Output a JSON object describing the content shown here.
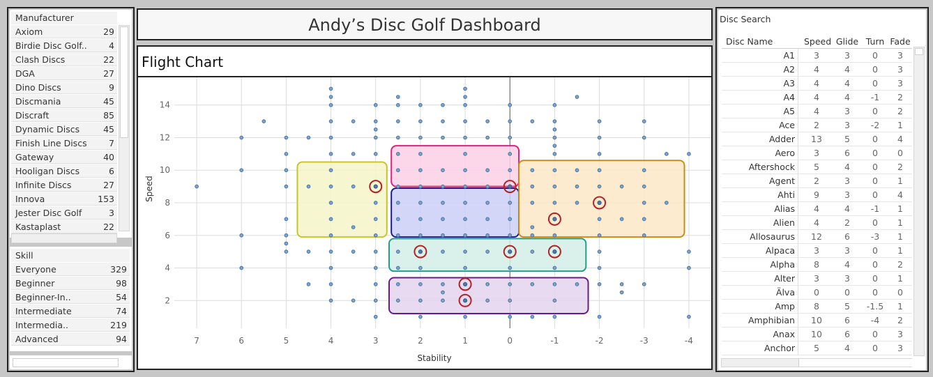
{
  "manufacturer": {
    "header": "Manufacturer",
    "items": [
      {
        "name": "Axiom",
        "count": "29"
      },
      {
        "name": "Birdie Disc Golf..",
        "count": "4"
      },
      {
        "name": "Clash Discs",
        "count": "22"
      },
      {
        "name": "DGA",
        "count": "27"
      },
      {
        "name": "Dino Discs",
        "count": "9"
      },
      {
        "name": "Discmania",
        "count": "45"
      },
      {
        "name": "Discraft",
        "count": "85"
      },
      {
        "name": "Dynamic Discs",
        "count": "45"
      },
      {
        "name": "Finish Line Discs",
        "count": "7"
      },
      {
        "name": "Gateway",
        "count": "40"
      },
      {
        "name": "Hooligan Discs",
        "count": "6"
      },
      {
        "name": "Infinite Discs",
        "count": "27"
      },
      {
        "name": "Innova",
        "count": "153"
      },
      {
        "name": "Jester Disc Golf",
        "count": "3"
      },
      {
        "name": "Kastaplast",
        "count": "22"
      }
    ]
  },
  "skill": {
    "header": "Skill",
    "items": [
      {
        "name": "Everyone",
        "count": "329"
      },
      {
        "name": "Beginner",
        "count": "98"
      },
      {
        "name": "Beginner-In..",
        "count": "54"
      },
      {
        "name": "Intermediate",
        "count": "74"
      },
      {
        "name": "Intermedia..",
        "count": "219"
      },
      {
        "name": "Advanced",
        "count": "94"
      }
    ]
  },
  "dashboard_title": "Andy’s Disc Golf Dashboard",
  "chart_title": "Flight Chart",
  "chart_data": {
    "type": "scatter",
    "xlabel": "Stability",
    "ylabel": "Speed",
    "xlim": [
      7.5,
      -4.5
    ],
    "ylim": [
      0.3,
      15.7
    ],
    "x_ticks": [
      7,
      6,
      5,
      4,
      3,
      2,
      1,
      0,
      -1,
      -2,
      -3,
      -4
    ],
    "y_ticks": [
      2,
      4,
      6,
      8,
      10,
      12,
      14
    ],
    "grid": true,
    "reversed_x": true,
    "points": [
      [
        7,
        9
      ],
      [
        6,
        12
      ],
      [
        6,
        10
      ],
      [
        6,
        6
      ],
      [
        6,
        4
      ],
      [
        5.5,
        13
      ],
      [
        5,
        12
      ],
      [
        5,
        11
      ],
      [
        5,
        10
      ],
      [
        5,
        9
      ],
      [
        5,
        7
      ],
      [
        5,
        6
      ],
      [
        5,
        5.5
      ],
      [
        5,
        5
      ],
      [
        4.5,
        12
      ],
      [
        4.5,
        9
      ],
      [
        4.5,
        5
      ],
      [
        4.5,
        3
      ],
      [
        4,
        15
      ],
      [
        4,
        14.5
      ],
      [
        4,
        14
      ],
      [
        4,
        13
      ],
      [
        4,
        12
      ],
      [
        4,
        11
      ],
      [
        4,
        10
      ],
      [
        4,
        9
      ],
      [
        4,
        8
      ],
      [
        4,
        7
      ],
      [
        4,
        6
      ],
      [
        4,
        5
      ],
      [
        4,
        4
      ],
      [
        4,
        3
      ],
      [
        4,
        2
      ],
      [
        3.5,
        13
      ],
      [
        3.5,
        11
      ],
      [
        3.5,
        9
      ],
      [
        3.5,
        6.5
      ],
      [
        3.5,
        5
      ],
      [
        3.5,
        2
      ],
      [
        3,
        14
      ],
      [
        3,
        13
      ],
      [
        3,
        12.5
      ],
      [
        3,
        12
      ],
      [
        3,
        11
      ],
      [
        3,
        9
      ],
      [
        3,
        8
      ],
      [
        3,
        7
      ],
      [
        3,
        6
      ],
      [
        3,
        5
      ],
      [
        3,
        4
      ],
      [
        3,
        3
      ],
      [
        3,
        2
      ],
      [
        3,
        1
      ],
      [
        2.5,
        14.5
      ],
      [
        2.5,
        14
      ],
      [
        2.5,
        13
      ],
      [
        2.5,
        12
      ],
      [
        2.5,
        11
      ],
      [
        2.5,
        10
      ],
      [
        2.5,
        9
      ],
      [
        2.5,
        8
      ],
      [
        2.5,
        7
      ],
      [
        2.5,
        6
      ],
      [
        2.5,
        5
      ],
      [
        2.5,
        4
      ],
      [
        2.5,
        3
      ],
      [
        2.5,
        2
      ],
      [
        2,
        14
      ],
      [
        2,
        13
      ],
      [
        2,
        12
      ],
      [
        2,
        11
      ],
      [
        2,
        10
      ],
      [
        2,
        9
      ],
      [
        2,
        8
      ],
      [
        2,
        7
      ],
      [
        2,
        6
      ],
      [
        2,
        5
      ],
      [
        2,
        4
      ],
      [
        2,
        3
      ],
      [
        2,
        2
      ],
      [
        2,
        1
      ],
      [
        1.5,
        14
      ],
      [
        1.5,
        13
      ],
      [
        1.5,
        12
      ],
      [
        1.5,
        10
      ],
      [
        1.5,
        9
      ],
      [
        1.5,
        8
      ],
      [
        1.5,
        7
      ],
      [
        1.5,
        6
      ],
      [
        1.5,
        5
      ],
      [
        1.5,
        3
      ],
      [
        1.5,
        2.5
      ],
      [
        1.5,
        2
      ],
      [
        1,
        15
      ],
      [
        1,
        14.5
      ],
      [
        1,
        14
      ],
      [
        1,
        13
      ],
      [
        1,
        12
      ],
      [
        1,
        11
      ],
      [
        1,
        10
      ],
      [
        1,
        9
      ],
      [
        1,
        8
      ],
      [
        1,
        7
      ],
      [
        1,
        6
      ],
      [
        1,
        5
      ],
      [
        1,
        4
      ],
      [
        1,
        3
      ],
      [
        1,
        2
      ],
      [
        1,
        1
      ],
      [
        0.5,
        13
      ],
      [
        0.5,
        12
      ],
      [
        0.5,
        10
      ],
      [
        0.5,
        9
      ],
      [
        0.5,
        8
      ],
      [
        0.5,
        7
      ],
      [
        0.5,
        6
      ],
      [
        0.5,
        5
      ],
      [
        0.5,
        3
      ],
      [
        0.5,
        2
      ],
      [
        0,
        14
      ],
      [
        0,
        13
      ],
      [
        0,
        12
      ],
      [
        0,
        11
      ],
      [
        0,
        10
      ],
      [
        0,
        9
      ],
      [
        0,
        8
      ],
      [
        0,
        7
      ],
      [
        0,
        6
      ],
      [
        0,
        5
      ],
      [
        0,
        4
      ],
      [
        0,
        3
      ],
      [
        0,
        2
      ],
      [
        0,
        1
      ],
      [
        -0.5,
        13
      ],
      [
        -0.5,
        10
      ],
      [
        -0.5,
        9
      ],
      [
        -0.5,
        8
      ],
      [
        -0.5,
        6.5
      ],
      [
        -0.5,
        6
      ],
      [
        -0.5,
        5
      ],
      [
        -0.5,
        3
      ],
      [
        -0.5,
        1
      ],
      [
        -1,
        14
      ],
      [
        -1,
        13
      ],
      [
        -1,
        12.5
      ],
      [
        -1,
        12
      ],
      [
        -1,
        11.5
      ],
      [
        -1,
        11
      ],
      [
        -1,
        10
      ],
      [
        -1,
        9
      ],
      [
        -1,
        8
      ],
      [
        -1,
        7
      ],
      [
        -1,
        6
      ],
      [
        -1,
        5
      ],
      [
        -1,
        4
      ],
      [
        -1,
        3
      ],
      [
        -1,
        2
      ],
      [
        -1,
        1
      ],
      [
        -1.5,
        14.5
      ],
      [
        -1.5,
        10
      ],
      [
        -1.5,
        9
      ],
      [
        -1.5,
        8
      ],
      [
        -1.5,
        3
      ],
      [
        -2,
        13
      ],
      [
        -2,
        12
      ],
      [
        -2,
        11
      ],
      [
        -2,
        10
      ],
      [
        -2,
        9
      ],
      [
        -2,
        8
      ],
      [
        -2,
        7
      ],
      [
        -2,
        6
      ],
      [
        -2,
        5
      ],
      [
        -2,
        4
      ],
      [
        -2,
        3
      ],
      [
        -2,
        1
      ],
      [
        -2.5,
        9
      ],
      [
        -2.5,
        7
      ],
      [
        -2.5,
        3
      ],
      [
        -2.5,
        2.5
      ],
      [
        -3,
        13
      ],
      [
        -3,
        12
      ],
      [
        -3,
        10
      ],
      [
        -3,
        9
      ],
      [
        -3,
        8
      ],
      [
        -3,
        7
      ],
      [
        -3,
        6
      ],
      [
        -3,
        3
      ],
      [
        -3.5,
        11
      ],
      [
        -3.5,
        8
      ],
      [
        -4,
        11
      ],
      [
        -4,
        5
      ],
      [
        -4,
        4
      ],
      [
        -4,
        1
      ]
    ],
    "highlighted": [
      [
        3,
        9
      ],
      [
        0,
        9
      ],
      [
        -2,
        8
      ],
      [
        -1,
        7
      ],
      [
        2,
        5
      ],
      [
        0,
        5
      ],
      [
        -1,
        5
      ],
      [
        1,
        3
      ],
      [
        1,
        2
      ]
    ],
    "regions": [
      {
        "x": [
          4.75,
          2.75
        ],
        "y": [
          5.9,
          10.5
        ],
        "fill": "#f4f4c8",
        "stroke": "#c9c42a"
      },
      {
        "x": [
          2.65,
          -0.2
        ],
        "y": [
          9.0,
          11.5
        ],
        "fill": "#fbd0e6",
        "stroke": "#e0207c"
      },
      {
        "x": [
          2.65,
          -0.2
        ],
        "y": [
          5.9,
          8.9
        ],
        "fill": "#cccff7",
        "stroke": "#1c1c8c"
      },
      {
        "x": [
          -0.2,
          -3.9
        ],
        "y": [
          5.9,
          10.6
        ],
        "fill": "#fde8c8",
        "stroke": "#d08a10"
      },
      {
        "x": [
          2.7,
          -1.7
        ],
        "y": [
          3.8,
          5.8
        ],
        "fill": "#d2eee6",
        "stroke": "#20a08a"
      },
      {
        "x": [
          2.7,
          -1.75
        ],
        "y": [
          1.2,
          3.4
        ],
        "fill": "#e3d4ee",
        "stroke": "#6a1a8a"
      }
    ]
  },
  "disc_search": {
    "title": "Disc Search",
    "columns": [
      "Disc Name",
      "Speed",
      "Glide",
      "Turn",
      "Fade"
    ],
    "rows": [
      [
        "A1",
        "3",
        "3",
        "0",
        "3"
      ],
      [
        "A2",
        "4",
        "4",
        "0",
        "3"
      ],
      [
        "A3",
        "4",
        "4",
        "0",
        "3"
      ],
      [
        "A4",
        "4",
        "4",
        "-1",
        "2"
      ],
      [
        "A5",
        "4",
        "3",
        "0",
        "2"
      ],
      [
        "Ace",
        "2",
        "3",
        "-2",
        "1"
      ],
      [
        "Adder",
        "13",
        "5",
        "0",
        "4"
      ],
      [
        "Aero",
        "3",
        "6",
        "0",
        "0"
      ],
      [
        "Aftershock",
        "5",
        "4",
        "0",
        "2"
      ],
      [
        "Agent",
        "2",
        "3",
        "0",
        "1"
      ],
      [
        "Ahti",
        "9",
        "3",
        "0",
        "4"
      ],
      [
        "Alias",
        "4",
        "4",
        "-1",
        "1"
      ],
      [
        "Alien",
        "4",
        "2",
        "0",
        "1"
      ],
      [
        "Allosaurus",
        "12",
        "6",
        "-3",
        "1"
      ],
      [
        "Alpaca",
        "3",
        "3",
        "0",
        "1"
      ],
      [
        "Alpha",
        "8",
        "4",
        "0",
        "2"
      ],
      [
        "Alter",
        "3",
        "3",
        "0",
        "1"
      ],
      [
        "Älva",
        "0",
        "0",
        "0",
        "0"
      ],
      [
        "Amp",
        "8",
        "5",
        "-1.5",
        "1"
      ],
      [
        "Amphibian",
        "10",
        "6",
        "-4",
        "2"
      ],
      [
        "Anax",
        "10",
        "6",
        "0",
        "3"
      ],
      [
        "Anchor",
        "5",
        "4",
        "0",
        "3"
      ]
    ]
  },
  "colors": {
    "point": "#4e79a7",
    "highlight": "#b22222",
    "grid": "#dcdcdc"
  }
}
